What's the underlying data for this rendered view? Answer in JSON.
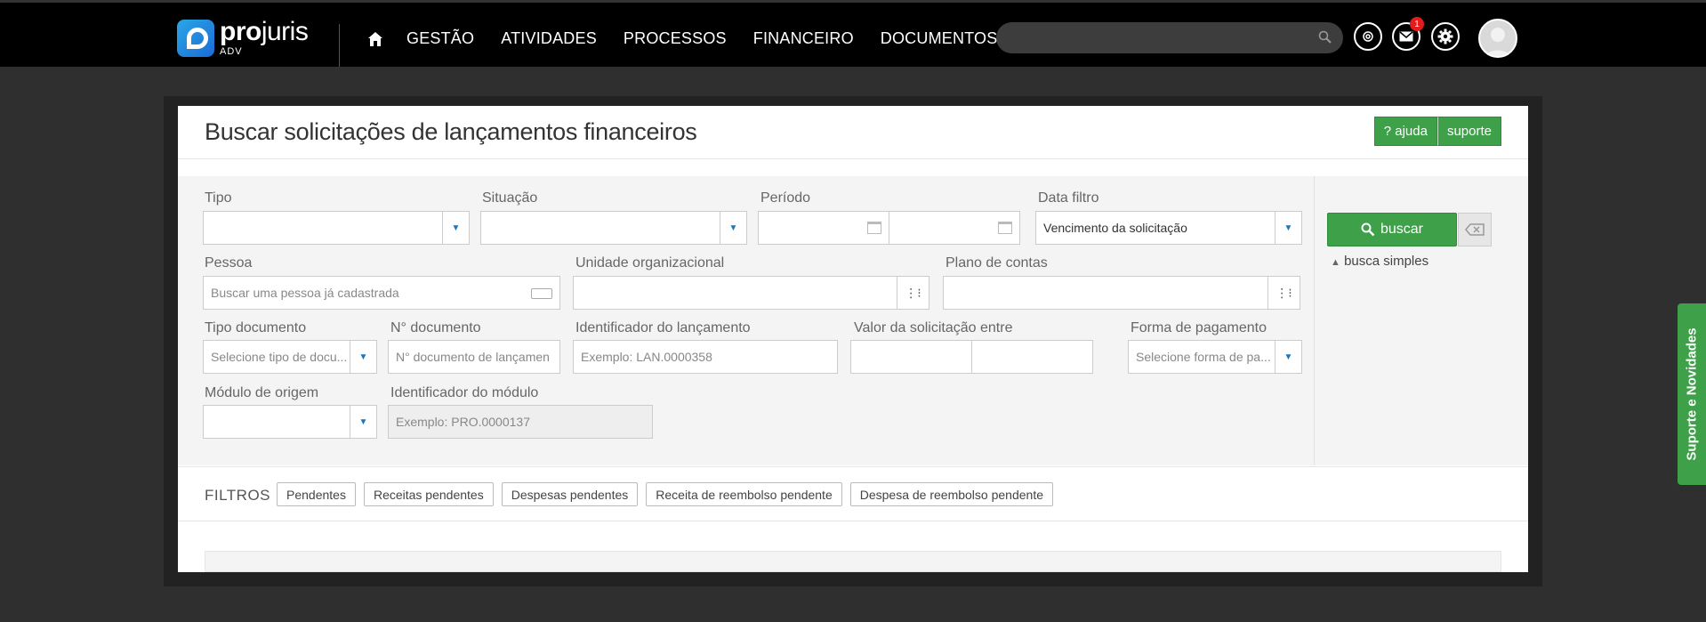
{
  "brand": {
    "name_bold": "pro",
    "name_rest": "juris",
    "sub": "ADV"
  },
  "nav": {
    "items": [
      "GESTÃO",
      "ATIVIDADES",
      "PROCESSOS",
      "FINANCEIRO",
      "DOCUMENTOS"
    ]
  },
  "notifications": {
    "count": "1"
  },
  "page": {
    "title": "Buscar solicitações de lançamentos financeiros",
    "help_label": "? ajuda",
    "support_label": "suporte"
  },
  "form": {
    "tipo": {
      "label": "Tipo",
      "value": ""
    },
    "situacao": {
      "label": "Situação",
      "value": ""
    },
    "periodo": {
      "label": "Período"
    },
    "data_filtro": {
      "label": "Data filtro",
      "value": "Vencimento da solicitação"
    },
    "pessoa": {
      "label": "Pessoa",
      "placeholder": "Buscar uma pessoa já cadastrada"
    },
    "unidade": {
      "label": "Unidade organizacional"
    },
    "plano": {
      "label": "Plano de contas"
    },
    "tipo_doc": {
      "label": "Tipo documento",
      "placeholder": "Selecione tipo de docu..."
    },
    "num_doc": {
      "label": "N° documento",
      "placeholder": "N° documento de lançamen"
    },
    "identificador": {
      "label": "Identificador do lançamento",
      "placeholder": "Exemplo: LAN.0000358"
    },
    "valor": {
      "label": "Valor da solicitação entre"
    },
    "forma_pag": {
      "label": "Forma de pagamento",
      "placeholder": "Selecione forma de pa..."
    },
    "modulo": {
      "label": "Módulo de origem"
    },
    "id_modulo": {
      "label": "Identificador do módulo",
      "placeholder": "Exemplo: PRO.0000137"
    }
  },
  "actions": {
    "buscar": "buscar",
    "simple": "busca simples"
  },
  "filters": {
    "label": "FILTROS",
    "chips": [
      "Pendentes",
      "Receitas pendentes",
      "Despesas pendentes",
      "Receita de reembolso pendente",
      "Despesa de reembolso pendente"
    ]
  },
  "side_tab": {
    "label": "Suporte e Novidades"
  },
  "colors": {
    "accent_green": "#3ea048",
    "topbar": "#000000",
    "badge_red": "#e41b1b"
  }
}
